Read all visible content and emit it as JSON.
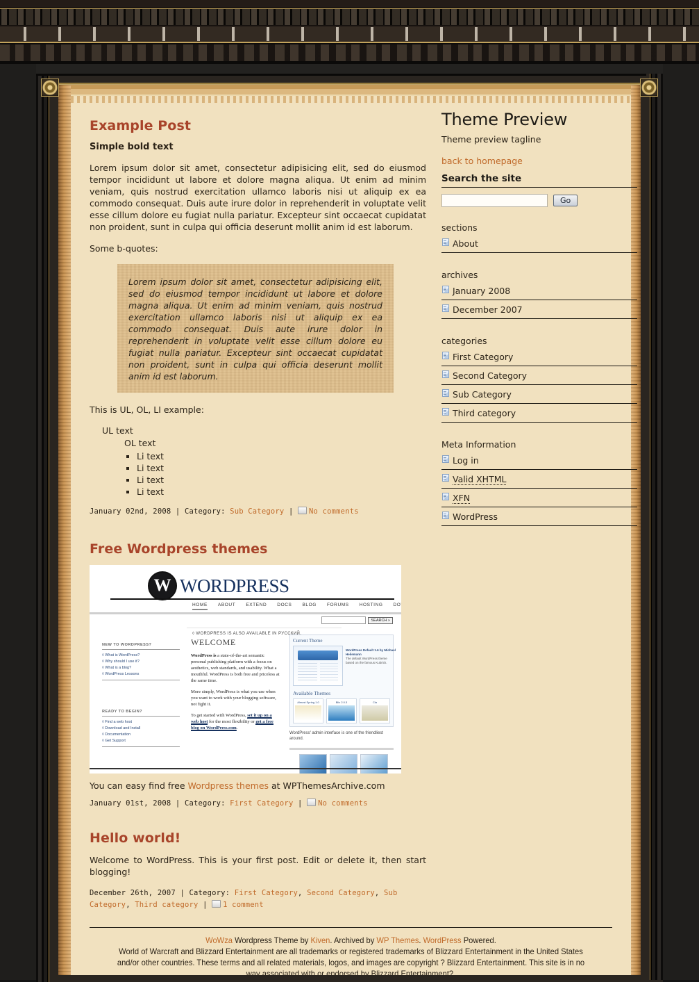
{
  "site": {
    "title": "Theme Preview",
    "tagline": "Theme preview tagline",
    "home_link": "back to homepage"
  },
  "search": {
    "heading": "Search the site",
    "value": "",
    "placeholder": "",
    "button": "Go"
  },
  "sidebar": {
    "sections": {
      "heading": "sections",
      "items": [
        {
          "label": "About"
        }
      ]
    },
    "archives": {
      "heading": "archives",
      "items": [
        {
          "label": "January 2008"
        },
        {
          "label": "December 2007"
        }
      ]
    },
    "categories": {
      "heading": "categories",
      "items": [
        {
          "label": "First Category"
        },
        {
          "label": "Second Category"
        },
        {
          "label": "Sub Category"
        },
        {
          "label": "Third category"
        }
      ]
    },
    "meta": {
      "heading": "Meta Information",
      "items": [
        {
          "label": "Log in",
          "dotted": false
        },
        {
          "label": "Valid XHTML",
          "dotted": true
        },
        {
          "label": "XFN",
          "dotted": true
        },
        {
          "label": "WordPress",
          "dotted": false
        }
      ]
    }
  },
  "posts": {
    "post1": {
      "title": "Example Post",
      "subheading": "Simple bold text",
      "paragraph": "Lorem ipsum dolor sit amet, consectetur adipisicing elit, sed do eiusmod tempor incididunt ut labore et dolore magna aliqua. Ut enim ad minim veniam, quis nostrud exercitation ullamco laboris nisi ut aliquip ex ea commodo consequat. Duis aute irure dolor in reprehenderit in voluptate velit esse cillum dolore eu fugiat nulla pariatur. Excepteur sint occaecat cupidatat non proident, sunt in culpa qui officia deserunt mollit anim id est laborum.",
      "quote_intro": "Some b-quotes:",
      "quote": "Lorem ipsum dolor sit amet, consectetur adipisicing elit, sed do eiusmod tempor incididunt ut labore et dolore magna aliqua. Ut enim ad minim veniam, quis nostrud exercitation ullamco laboris nisi ut aliquip ex ea commodo consequat. Duis aute irure dolor in reprehenderit in voluptate velit esse cillum dolore eu fugiat nulla pariatur. Excepteur sint occaecat cupidatat non proident, sunt in culpa qui officia deserunt mollit anim id est laborum.",
      "list_intro": "This is UL, OL, LI example:",
      "ul_text": "UL text",
      "ol_text": "OL text",
      "li_items": [
        "Li text",
        "Li text",
        "Li text",
        "Li text"
      ],
      "meta": {
        "date": "January 02nd, 2008",
        "sep1": " | Category: ",
        "category": "Sub Category",
        "sep2": " | ",
        "comments": "No comments"
      }
    },
    "post2": {
      "title": "Free Wordpress themes",
      "caption_pre": "You can easy find free ",
      "caption_link": "Wordpress themes",
      "caption_post": " at WPThemesArchive.com",
      "meta": {
        "date": "January 01st, 2008",
        "sep1": " | Category: ",
        "category": "First Category",
        "sep2": " | ",
        "comments": "No comments"
      }
    },
    "post3": {
      "title": "Hello world!",
      "paragraph": "Welcome to WordPress. This is your first post. Edit or delete it, then start blogging!",
      "meta": {
        "date": "December 26th, 2007",
        "sep1": " | Category: ",
        "categories": [
          "First Category",
          "Second Category",
          "Sub Category",
          "Third category"
        ],
        "sep2": " | ",
        "comments": "1 comment"
      }
    }
  },
  "screenshot": {
    "alt": "wordpress-org-homepage-screenshot",
    "brand": "WORDPRESS",
    "brand_mark": "W",
    "nav": [
      "HOME",
      "ABOUT",
      "EXTEND",
      "DOCS",
      "BLOG",
      "FORUMS",
      "HOSTING",
      "DOWNLOAD"
    ],
    "search_button": "SEARCH »",
    "search_value": "",
    "russian_note": "◊ WORDPRESS IS ALSO AVAILABLE IN РУССКИЙ.",
    "new_heading": "NEW TO WORDPRESS?",
    "new_links": [
      "◊ What is WordPress?",
      "◊ Why should I use it?",
      "◊ What is a blog?",
      "◊ WordPress Lessons"
    ],
    "ready_heading": "READY TO BEGIN?",
    "ready_links": [
      "◊ Find a web host",
      "◊ Download and Install",
      "◊ Documentation",
      "◊ Get Support"
    ],
    "welcome_heading": "WELCOME",
    "welcome_p1_b": "WordPress is",
    "welcome_p1": " a state-of-the-art semantic personal publishing platform with a focus on aesthetics, web standards, and usability. What a mouthful. WordPress is both free and priceless at the same time.",
    "welcome_p2": "More simply, WordPress is what you use when you want to work with your blogging software, not fight it.",
    "welcome_p3_pre": "To get started with WordPress, ",
    "welcome_p3_a1": "set it up on a web host",
    "welcome_p3_mid": " for the most flexibility or ",
    "welcome_p3_a2": "get a free blog on WordPress.com",
    "welcome_p3_end": ".",
    "current_theme_heading": "Current Theme",
    "current_theme_name": "WordPress Default 1.6 by Michael Heilemann",
    "current_theme_desc": "The default WordPress theme based on the famous Kubrick.",
    "available_heading": "Available Themes",
    "available_themes": [
      "Almost Spring 1.0",
      "Blix 2.0.3",
      "Cla"
    ],
    "admin_caption": "WordPress' admin interface is one of the friendliest around."
  },
  "footer": {
    "theme_name": "WoWza",
    "text1": " Wordpress Theme by ",
    "author": "Kiven",
    "text2": ". Archived by ",
    "archiver": "WP Themes",
    "text3": ". ",
    "platform": "WordPress",
    "text4": " Powered.",
    "disclaimer": "World of Warcraft and Blizzard Entertainment are all trademarks or registered trademarks of Blizzard Entertainment in the United States and/or other countries. These terms and all related materials, logos, and images are copyright ? Blizzard Entertainment. This site is in no way associated with or endorsed by Blizzard Entertainment?."
  },
  "colors": {
    "paper": "#f1e1bf",
    "heading": "#a8442a",
    "link": "#c06a2a",
    "text": "#2b2318",
    "quote_bg": "#ddbe8c",
    "frame": "#1b1a19",
    "gold": "#c2a35c"
  }
}
